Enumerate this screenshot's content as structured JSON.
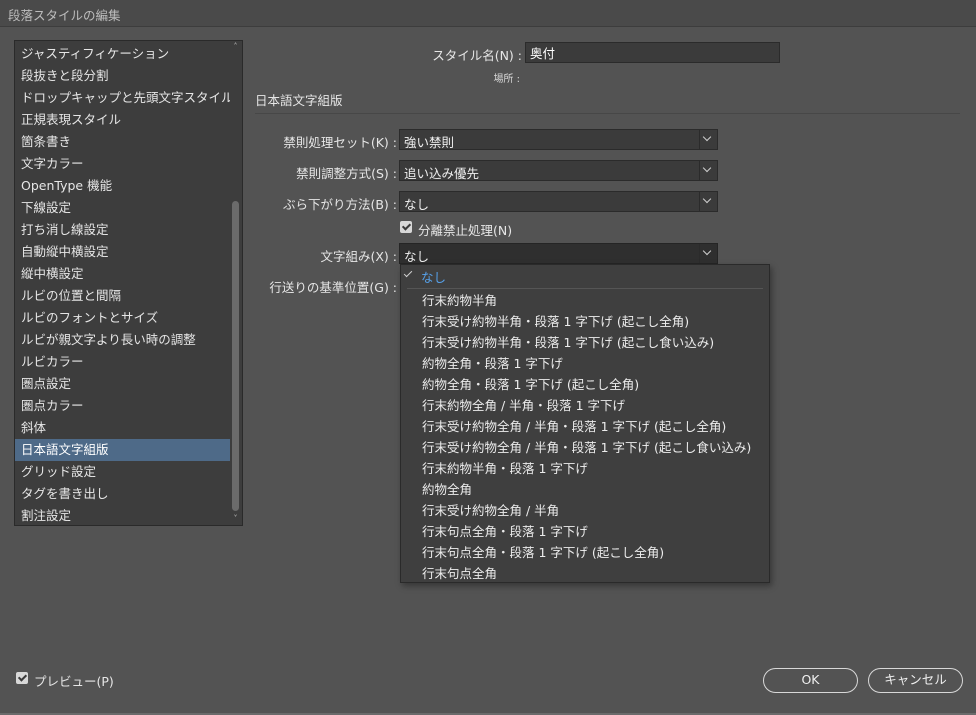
{
  "window": {
    "title": "段落スタイルの編集"
  },
  "sidebar": {
    "items": [
      "ジャスティフィケーション",
      "段抜きと段分割",
      "ドロップキャップと先頭文字スタイル",
      "正規表現スタイル",
      "箇条書き",
      "文字カラー",
      "OpenType 機能",
      "下線設定",
      "打ち消し線設定",
      "自動縦中横設定",
      "縦中横設定",
      "ルビの位置と間隔",
      "ルビのフォントとサイズ",
      "ルビが親文字より長い時の調整",
      "ルビカラー",
      "圏点設定",
      "圏点カラー",
      "斜体",
      "日本語文字組版",
      "グリッド設定",
      "タグを書き出し",
      "割注設定"
    ],
    "selected_index": 18
  },
  "form": {
    "style_name_label": "スタイル名(N) :",
    "style_name_value": "奥付",
    "location_label": "場所 :",
    "section_title": "日本語文字組版",
    "kinsoku_set": {
      "label": "禁則処理セット(K) :",
      "value": "強い禁則"
    },
    "kinsoku_adjust": {
      "label": "禁則調整方式(S) :",
      "value": "追い込み優先"
    },
    "burasagari": {
      "label": "ぶら下がり方法(B) :",
      "value": "なし"
    },
    "bunri_kinshi": {
      "label": "分離禁止処理(N)",
      "checked": true
    },
    "mojikumi": {
      "label": "文字組み(X) :",
      "value": "なし"
    },
    "line_base": {
      "label": "行送りの基準位置(G) :"
    }
  },
  "dropdown": {
    "selected": "なし",
    "options": [
      "行末約物半角",
      "行末受け約物半角・段落 1 字下げ (起こし全角)",
      "行末受け約物半角・段落 1 字下げ (起こし食い込み)",
      "約物全角・段落 1 字下げ",
      "約物全角・段落 1 字下げ (起こし全角)",
      "行末約物全角 / 半角・段落 1 字下げ",
      "行末受け約物全角 / 半角・段落 1 字下げ (起こし全角)",
      "行末受け約物全角 / 半角・段落 1 字下げ (起こし食い込み)",
      "行末約物半角・段落 1 字下げ",
      "約物全角",
      "行末受け約物全角 / 半角",
      "行末句点全角・段落 1 字下げ",
      "行末句点全角・段落 1 字下げ (起こし全角)",
      "行末句点全角"
    ]
  },
  "footer": {
    "preview_label": "プレビュー(P)",
    "preview_checked": true,
    "ok_label": "OK",
    "cancel_label": "キャンセル"
  }
}
